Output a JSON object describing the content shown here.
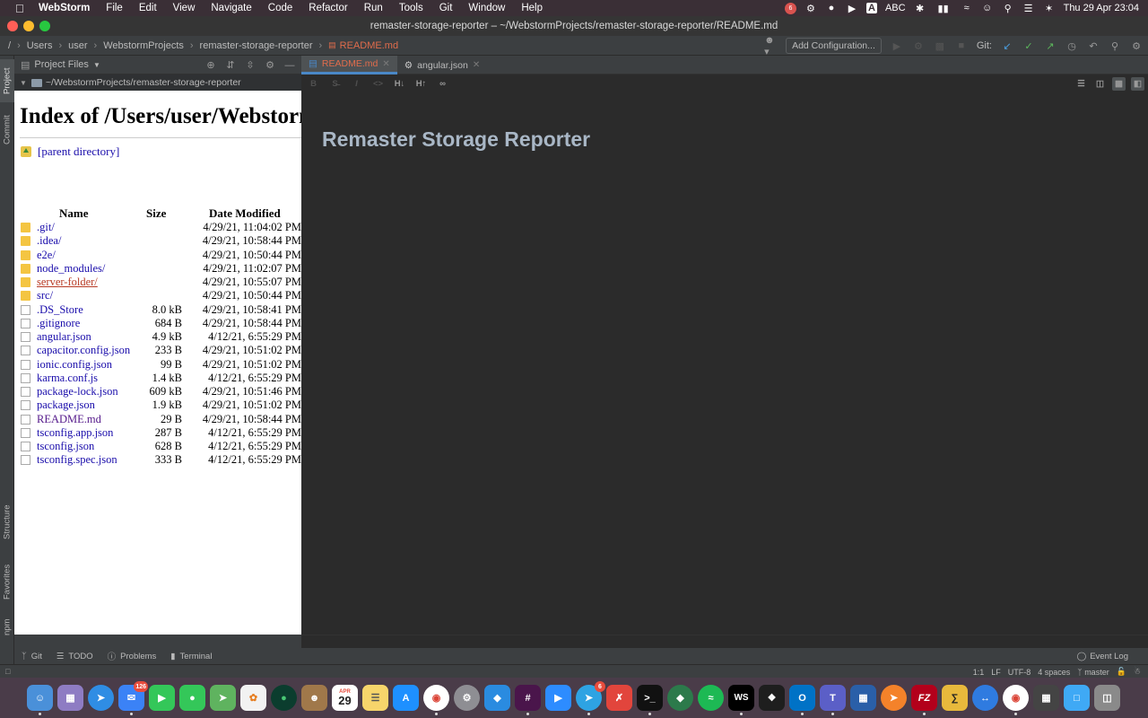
{
  "menubar": {
    "app": "WebStorm",
    "items": [
      "File",
      "Edit",
      "View",
      "Navigate",
      "Code",
      "Refactor",
      "Run",
      "Tools",
      "Git",
      "Window",
      "Help"
    ],
    "notification_badge": "6",
    "input_source": "ABC",
    "datetime": "Thu 29 Apr  23:04"
  },
  "window": {
    "title": "remaster-storage-reporter – ~/WebstormProjects/remaster-storage-reporter/README.md"
  },
  "breadcrumbs": [
    "/",
    "Users",
    "user",
    "WebstormProjects",
    "remaster-storage-reporter",
    "README.md"
  ],
  "toolbar": {
    "add_configuration": "Add Configuration...",
    "git_label": "Git:"
  },
  "left_tool_tabs": [
    "Project",
    "Commit",
    "Structure",
    "Favorites",
    "npm"
  ],
  "project_panel": {
    "title": "Project Files",
    "root": "~/WebstormProjects/remaster-storage-reporter"
  },
  "listing": {
    "heading": "Index of /Users/user/WebstormProjects/remaster-storage-reporter/",
    "parent": "[parent directory]",
    "columns": {
      "name": "Name",
      "size": "Size",
      "date": "Date Modified"
    },
    "rows": [
      {
        "type": "folder",
        "name": ".git/",
        "size": "",
        "date": "4/29/21, 11:04:02 PM"
      },
      {
        "type": "folder",
        "name": ".idea/",
        "size": "",
        "date": "4/29/21, 10:58:44 PM"
      },
      {
        "type": "folder",
        "name": "e2e/",
        "size": "",
        "date": "4/29/21, 10:50:44 PM"
      },
      {
        "type": "folder",
        "name": "node_modules/",
        "size": "",
        "date": "4/29/21, 11:02:07 PM"
      },
      {
        "type": "folder",
        "name": "server-folder/",
        "size": "",
        "date": "4/29/21, 10:55:07 PM",
        "state": "visited"
      },
      {
        "type": "folder",
        "name": "src/",
        "size": "",
        "date": "4/29/21, 10:50:44 PM"
      },
      {
        "type": "file",
        "name": ".DS_Store",
        "size": "8.0 kB",
        "date": "4/29/21, 10:58:41 PM"
      },
      {
        "type": "file",
        "name": ".gitignore",
        "size": "684 B",
        "date": "4/29/21, 10:58:44 PM"
      },
      {
        "type": "file",
        "name": "angular.json",
        "size": "4.9 kB",
        "date": "4/12/21, 6:55:29 PM"
      },
      {
        "type": "file",
        "name": "capacitor.config.json",
        "size": "233 B",
        "date": "4/29/21, 10:51:02 PM"
      },
      {
        "type": "file",
        "name": "ionic.config.json",
        "size": "99 B",
        "date": "4/29/21, 10:51:02 PM"
      },
      {
        "type": "file",
        "name": "karma.conf.js",
        "size": "1.4 kB",
        "date": "4/12/21, 6:55:29 PM"
      },
      {
        "type": "file",
        "name": "package-lock.json",
        "size": "609 kB",
        "date": "4/29/21, 10:51:46 PM"
      },
      {
        "type": "file",
        "name": "package.json",
        "size": "1.9 kB",
        "date": "4/29/21, 10:51:02 PM"
      },
      {
        "type": "file",
        "name": "README.md",
        "size": "29 B",
        "date": "4/29/21, 10:58:44 PM",
        "state": "readme"
      },
      {
        "type": "file",
        "name": "tsconfig.app.json",
        "size": "287 B",
        "date": "4/12/21, 6:55:29 PM"
      },
      {
        "type": "file",
        "name": "tsconfig.json",
        "size": "628 B",
        "date": "4/12/21, 6:55:29 PM"
      },
      {
        "type": "file",
        "name": "tsconfig.spec.json",
        "size": "333 B",
        "date": "4/12/21, 6:55:29 PM"
      }
    ]
  },
  "editor": {
    "tabs": [
      {
        "label": "README.md",
        "active": true
      },
      {
        "label": "angular.json",
        "active": false
      }
    ],
    "preview_heading": "Remaster Storage Reporter"
  },
  "bottom_tabs": [
    "Git",
    "TODO",
    "Problems",
    "Terminal"
  ],
  "event_log": "Event Log",
  "status": {
    "position": "1:1",
    "line_sep": "LF",
    "encoding": "UTF-8",
    "indent": "4 spaces",
    "branch": "master"
  },
  "dock": {
    "mail_badge": "126",
    "calendar_month": "APR",
    "calendar_day": "29",
    "telegram_badge": "6"
  }
}
